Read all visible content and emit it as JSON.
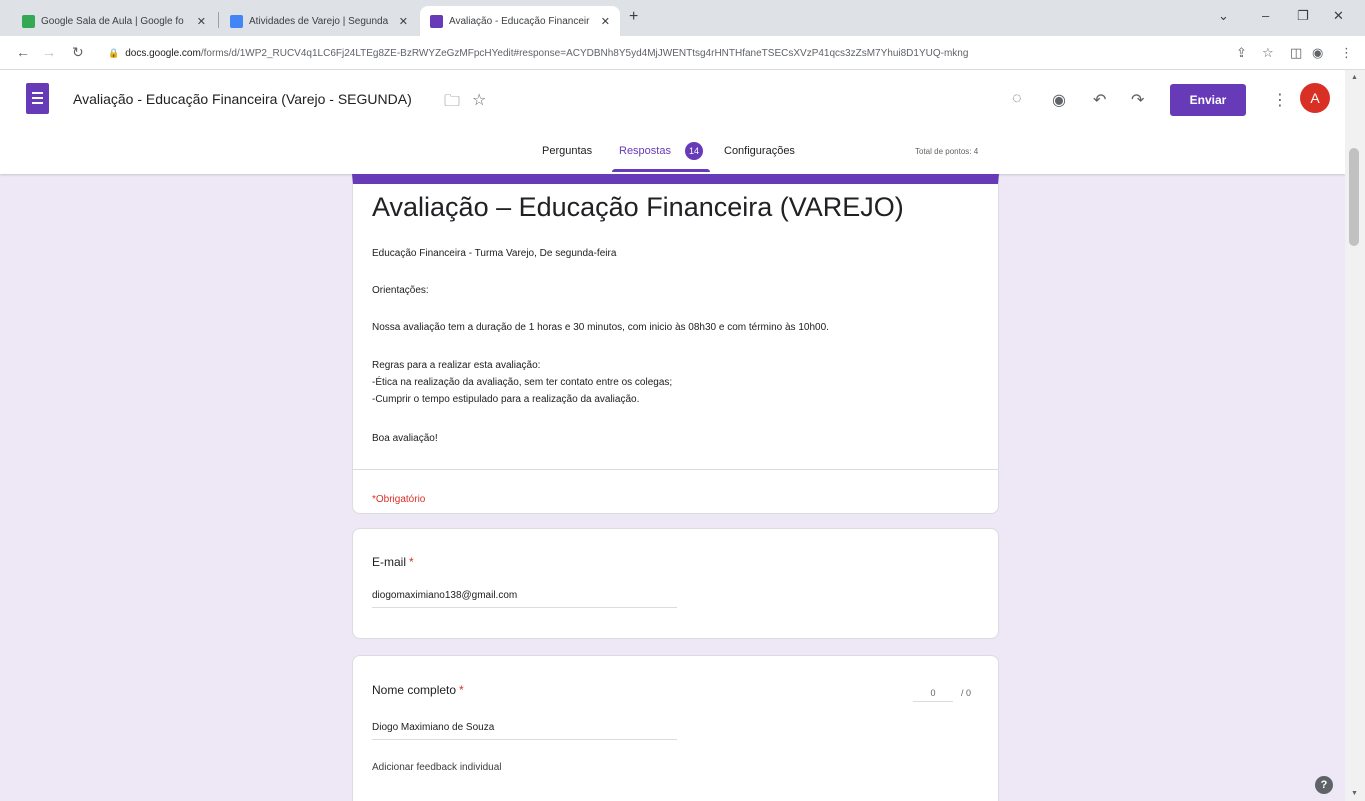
{
  "browser": {
    "tabs": [
      {
        "title": "Google Sala de Aula | Google fo",
        "favicon_color": "#34a853"
      },
      {
        "title": "Atividades de Varejo | Segunda",
        "favicon_color": "#4285f4"
      },
      {
        "title": "Avaliação - Educação Financeir",
        "favicon_color": "#673ab7"
      }
    ],
    "url_host": "docs.google.com",
    "url_path": "/forms/d/1WP2_RUCV4q1LC6Fj24LTEg8ZE-BzRWYZeGzMFpcHYedit#response=ACYDBNh8Y5yd4MjJWENTtsg4rHNTHfaneTSECsXVzP41qcs3zZsM7Yhui8D1YUQ-mkng"
  },
  "form_header": {
    "doc_title": "Avaliação - Educação Financeira (Varejo - SEGUNDA)",
    "send_label": "Enviar",
    "avatar_initial": "A",
    "tabs": {
      "questions": "Perguntas",
      "responses": "Respostas",
      "responses_count": "14",
      "settings": "Configurações"
    },
    "total_points": "Total de pontos: 4"
  },
  "title_card": {
    "title": "Avaliação – Educação Financeira (VAREJO)",
    "description_lines": [
      "Educação Financeira - Turma Varejo, De segunda-feira",
      "Orientações:",
      "Nossa avaliação tem a duração de  1 horas e 30 minutos, com inicio às 08h30 e com término às 10h00.",
      "Regras para a realizar esta avaliação:",
      "-Ética na realização da avaliação, sem ter contato entre os colegas;",
      "-Cumprir o tempo estipulado para a realização da avaliação.",
      "Boa avaliação!"
    ],
    "required_note": "*Obrigatório"
  },
  "email_card": {
    "label": "E-mail",
    "required_star": "*",
    "value": "diogomaximiano138@gmail.com"
  },
  "name_card": {
    "label": "Nome completo",
    "required_star": "*",
    "value": "Diogo Maximiano de Souza",
    "score_value": "0",
    "score_total": "/ 0",
    "feedback_label": "Adicionar feedback individual"
  },
  "accent_color": "#673ab7",
  "required_color": "#d93025"
}
